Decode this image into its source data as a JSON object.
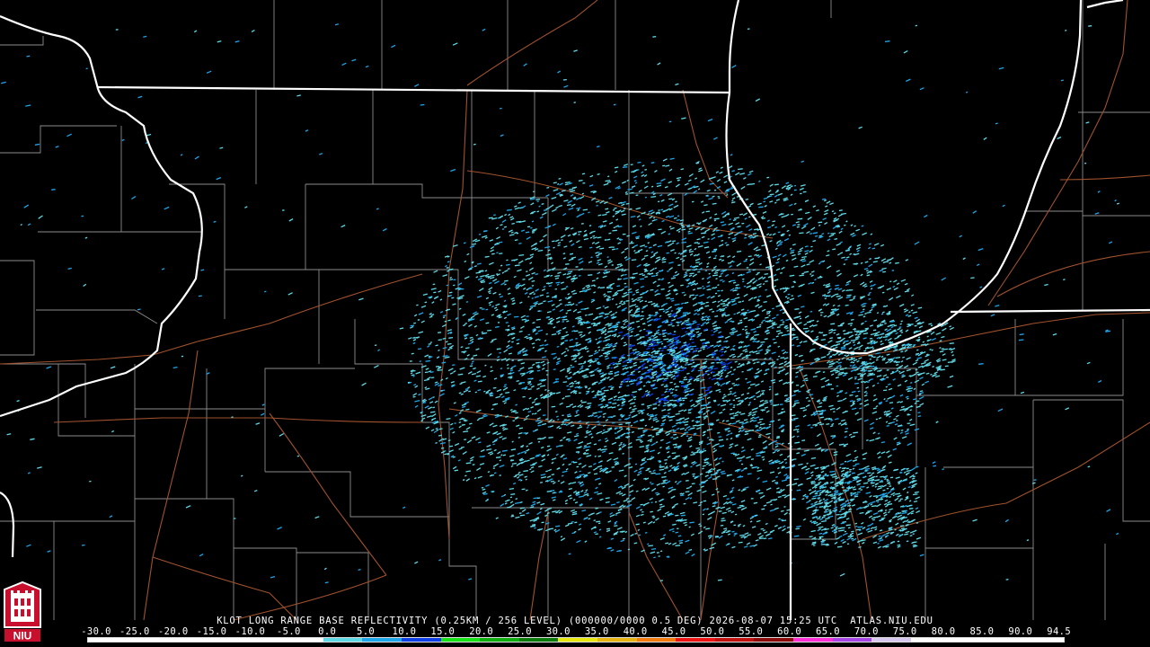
{
  "product": {
    "caption": "KLOT LONG RANGE BASE REFLECTIVITY (0.25KM / 256 LEVEL) (000000/0000 0.5 DEG) 2026-08-07 15:25 UTC  ATLAS.NIU.EDU",
    "station": "KLOT",
    "elevation": "0.5 DEG",
    "timestamp": "2026-08-07 15:25 UTC",
    "source": "ATLAS.NIU.EDU"
  },
  "logo": {
    "text": "NIU",
    "icon": "niu-seal-icon",
    "colors": {
      "red": "#c8102e",
      "white": "#ffffff"
    }
  },
  "color_scale": {
    "labels": [
      "-30.0",
      "-25.0",
      "-20.0",
      "-15.0",
      "-10.0",
      "-5.0",
      "0.0",
      "5.0",
      "10.0",
      "15.0",
      "20.0",
      "25.0",
      "30.0",
      "35.0",
      "40.0",
      "45.0",
      "50.0",
      "55.0",
      "60.0",
      "65.0",
      "70.0",
      "75.0",
      "80.0",
      "85.0",
      "90.0",
      "94.5"
    ],
    "stops": [
      {
        "from": -30,
        "to": 0,
        "color": "#ffffff"
      },
      {
        "from": 0,
        "to": 5,
        "color": "#5fd9e6"
      },
      {
        "from": 5,
        "to": 10,
        "color": "#1ea6ea"
      },
      {
        "from": 10,
        "to": 15,
        "color": "#0f3fe8"
      },
      {
        "from": 15,
        "to": 20,
        "color": "#16e216"
      },
      {
        "from": 20,
        "to": 25,
        "color": "#0fae0f"
      },
      {
        "from": 25,
        "to": 30,
        "color": "#0a7a0a"
      },
      {
        "from": 30,
        "to": 35,
        "color": "#e8e80f"
      },
      {
        "from": 35,
        "to": 40,
        "color": "#e8b40f"
      },
      {
        "from": 40,
        "to": 45,
        "color": "#f47b0f"
      },
      {
        "from": 45,
        "to": 50,
        "color": "#ef1414"
      },
      {
        "from": 50,
        "to": 55,
        "color": "#c40f0f"
      },
      {
        "from": 55,
        "to": 60,
        "color": "#8c0a0a"
      },
      {
        "from": 60,
        "to": 65,
        "color": "#ff2fd8"
      },
      {
        "from": 65,
        "to": 70,
        "color": "#a845e6"
      },
      {
        "from": 70,
        "to": 75,
        "color": "#d7c8f0"
      },
      {
        "from": 75,
        "to": 94.5,
        "color": "#ffffff"
      }
    ]
  },
  "colors": {
    "background": "#000000",
    "state_border": "#ffffff",
    "county_border": "#8c8c8c",
    "highway": "#a0522d",
    "echo_light": "#5fd9e6",
    "echo_mid": "#1ea6ea",
    "echo_dark": "#0f3fe8"
  }
}
